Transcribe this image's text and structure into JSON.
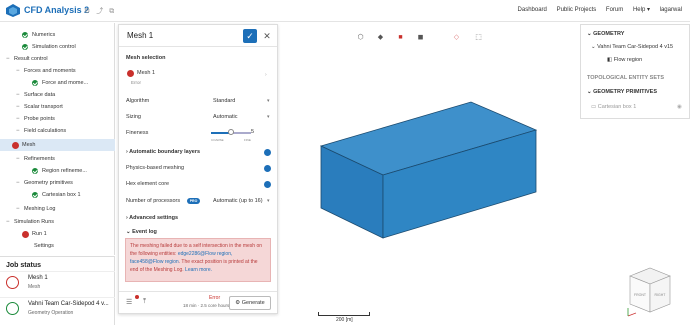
{
  "app": {
    "title": "CFD Analysis 2"
  },
  "topnav": {
    "dashboard": "Dashboard",
    "public_projects": "Public Projects",
    "forum": "Forum",
    "help": "Help ▾",
    "user": "lagarwal"
  },
  "tree": [
    {
      "label": "Numerics",
      "status": "ok"
    },
    {
      "label": "Simulation control",
      "status": "ok"
    },
    {
      "label": "Result control",
      "status": "none"
    },
    {
      "label": "Forces and moments",
      "status": "none"
    },
    {
      "label": "Force and mome...",
      "status": "ok"
    },
    {
      "label": "Surface data",
      "status": "none"
    },
    {
      "label": "Scalar transport",
      "status": "none"
    },
    {
      "label": "Probe points",
      "status": "none"
    },
    {
      "label": "Field calculations",
      "status": "none"
    },
    {
      "label": "Mesh",
      "status": "error"
    },
    {
      "label": "Refinements",
      "status": "none"
    },
    {
      "label": "Region refineme...",
      "status": "ok"
    },
    {
      "label": "Geometry primitives",
      "status": "none"
    },
    {
      "label": "Cartesian box 1",
      "status": "ok"
    },
    {
      "label": "Meshing Log",
      "status": "none"
    },
    {
      "label": "Simulation Runs",
      "status": "none"
    },
    {
      "label": "Run 1",
      "status": "error"
    },
    {
      "label": "Settings",
      "status": "none"
    }
  ],
  "jobs": {
    "title": "Job status",
    "items": [
      {
        "name": "Mesh 1",
        "sub": "Mesh",
        "color": "#c9302c"
      },
      {
        "name": "Vahni Team Car-Sidepod 4 v...",
        "sub": "Geometry Operation",
        "color": "#1a8a3a"
      }
    ]
  },
  "panel": {
    "title": "Mesh 1",
    "confirm": "✓",
    "close": "✕",
    "mesh_selection": "Mesh selection",
    "mesh_name": "Mesh 1",
    "mesh_status": "Error",
    "algorithm_label": "Algorithm",
    "algorithm_value": "Standard",
    "sizing_label": "Sizing",
    "sizing_value": "Automatic",
    "fineness_label": "Fineness",
    "fineness_value": "5",
    "fineness_level": 0.5,
    "coarse": "COARSE",
    "fine": "FINE",
    "auto_boundary": "Automatic boundary layers",
    "physics_meshing": "Physics-based meshing",
    "hex_core": "Hex element core",
    "processors_label": "Number of processors",
    "pro_badge": "PRO",
    "processors_value": "Automatic (up to 16)",
    "advanced": "Advanced settings",
    "event_log": "Event log",
    "error_text_1": "The meshing failed due to a self intersection in the mesh on the following entities: ",
    "error_link": "edge2286@Flow region, face458@Flow region",
    "error_text_2": ". The exact position is printed at the end of the Meshing Log. ",
    "error_more": "Learn more.",
    "footer_status": "Error",
    "footer_meta": "18 min · 2.5 core hours",
    "generate": "Generate"
  },
  "rpanel": {
    "geometry": "GEOMETRY",
    "geometry_item": "Vahni Team Car-Sidepod 4 v15",
    "flow_region": "Flow region",
    "topo_sets": "TOPOLOGICAL ENTITY SETS",
    "primitives": "GEOMETRY PRIMITIVES",
    "cart_box": "Cartesian box 1"
  },
  "viewcube": {
    "front": "FRONT",
    "right": "RIGHT"
  },
  "scale": {
    "label": "200 [m]"
  },
  "colors": {
    "accent": "#1d6fb8",
    "box_top": "#3e90cb",
    "box_front": "#2a7dbd",
    "box_side": "#1b5f93"
  }
}
